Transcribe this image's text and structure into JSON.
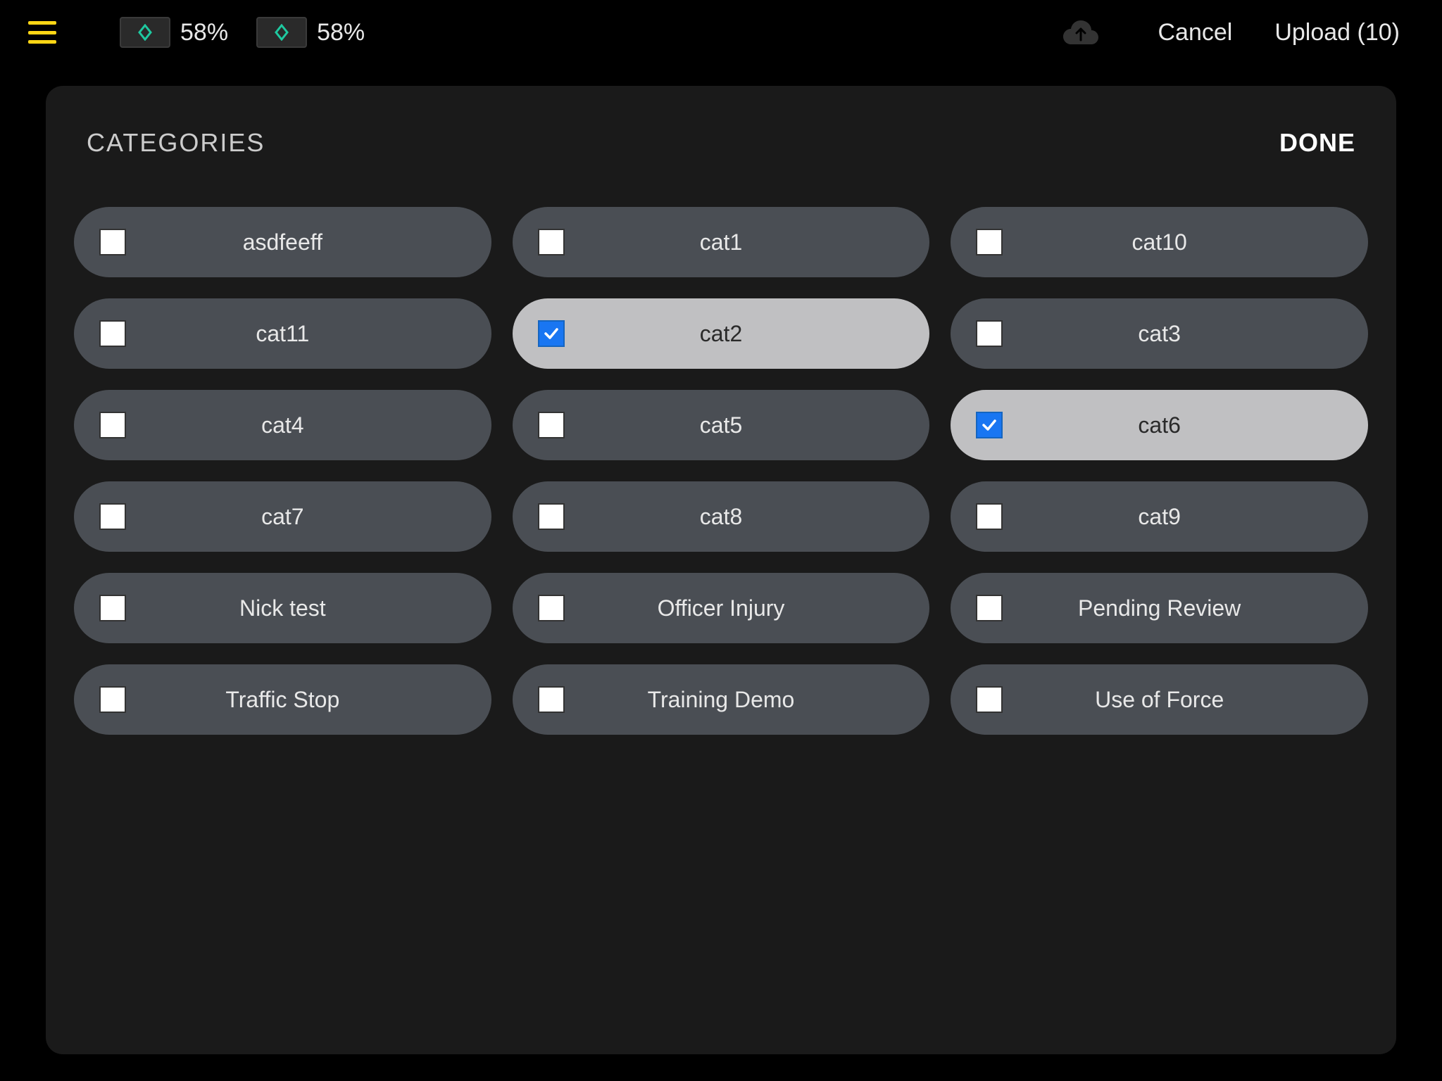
{
  "header": {
    "battery1_percent": "58%",
    "battery2_percent": "58%",
    "cancel_label": "Cancel",
    "upload_label": "Upload (10)"
  },
  "panel": {
    "title": "CATEGORIES",
    "done_label": "DONE"
  },
  "categories": [
    {
      "label": "asdfeeff",
      "selected": false
    },
    {
      "label": "cat1",
      "selected": false
    },
    {
      "label": "cat10",
      "selected": false
    },
    {
      "label": "cat11",
      "selected": false
    },
    {
      "label": "cat2",
      "selected": true
    },
    {
      "label": "cat3",
      "selected": false
    },
    {
      "label": "cat4",
      "selected": false
    },
    {
      "label": "cat5",
      "selected": false
    },
    {
      "label": "cat6",
      "selected": true
    },
    {
      "label": "cat7",
      "selected": false
    },
    {
      "label": "cat8",
      "selected": false
    },
    {
      "label": "cat9",
      "selected": false
    },
    {
      "label": "Nick test",
      "selected": false
    },
    {
      "label": "Officer Injury",
      "selected": false
    },
    {
      "label": "Pending Review",
      "selected": false
    },
    {
      "label": "Traffic Stop",
      "selected": false
    },
    {
      "label": "Training Demo",
      "selected": false
    },
    {
      "label": "Use of Force",
      "selected": false
    }
  ],
  "colors": {
    "accent_yellow": "#FFD615",
    "accent_teal": "#1EC9A0",
    "checkbox_blue": "#1976F2"
  }
}
